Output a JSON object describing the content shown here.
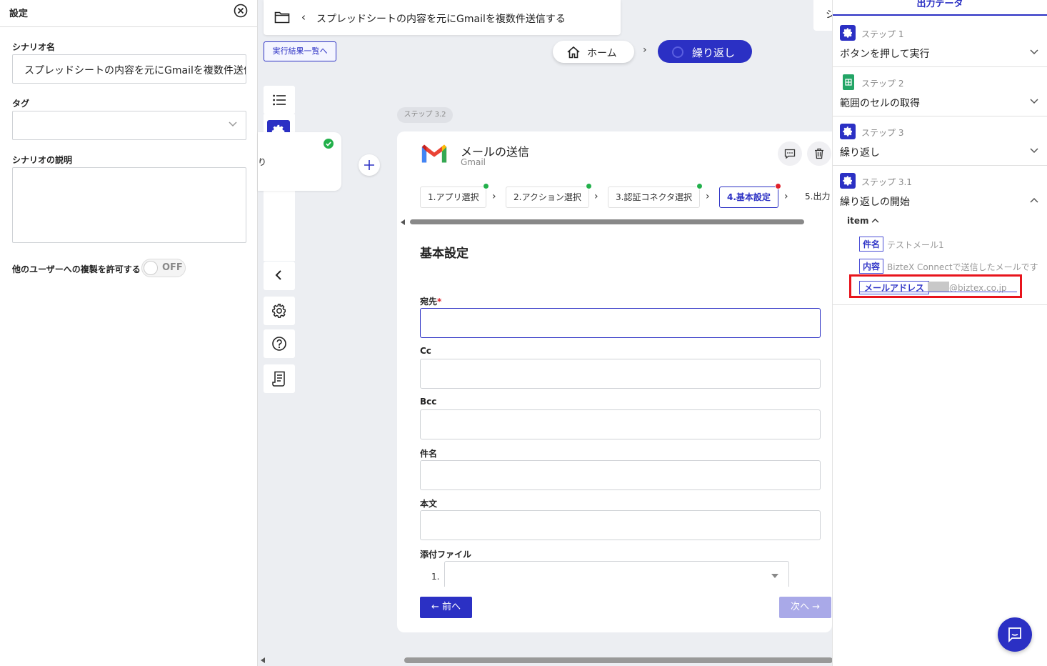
{
  "left_panel": {
    "title": "設定",
    "scenario_name_label": "シナリオ名",
    "scenario_name_value": "スプレッドシートの内容を元にGmailを複数件送信する",
    "tag_label": "タグ",
    "description_label": "シナリオの説明",
    "copy_permission_label": "他のユーザーへの複製を許可する",
    "toggle_state": "OFF"
  },
  "header": {
    "scenario_title": "スプレッドシートの内容を元にGmailを複数件送信する",
    "results_link": "実行結果一覧へ",
    "breadcrumb_home": "ホーム",
    "breadcrumb_current": "繰り返し",
    "right_truncated": "シ"
  },
  "canvas": {
    "partial_node_text": "り"
  },
  "step_card": {
    "step_badge": "ステップ 3.2",
    "title": "メールの送信",
    "subtitle": "Gmail",
    "tabs": [
      {
        "label": "1.アプリ選択",
        "status": "done"
      },
      {
        "label": "2.アクション選択",
        "status": "done"
      },
      {
        "label": "3.認証コネクタ選択",
        "status": "done"
      },
      {
        "label": "4.基本設定",
        "status": "error"
      },
      {
        "label": "5.出力"
      }
    ],
    "section_title": "基本設定",
    "fields": {
      "to_label": "宛先",
      "required_mark": "*",
      "cc_label": "Cc",
      "bcc_label": "Bcc",
      "subject_label": "件名",
      "body_label": "本文",
      "attachment_label": "添付ファイル",
      "attachment_index": "1."
    },
    "prev_button": "← 前へ",
    "next_button": "次へ →"
  },
  "right_panel": {
    "title": "出力データ",
    "steps": [
      {
        "step": "ステップ 1",
        "title": "ボタンを押して実行"
      },
      {
        "step": "ステップ 2",
        "title": "範囲のセルの取得"
      },
      {
        "step": "ステップ 3",
        "title": "繰り返し"
      },
      {
        "step": "ステップ 3.1",
        "title": "繰り返しの開始"
      }
    ],
    "item_label": "item",
    "outputs": [
      {
        "key": "件名",
        "value": "テストメール1"
      },
      {
        "key": "内容",
        "value": "BizteX Connectで送信したメールです"
      },
      {
        "key": "メールアドレス",
        "value": "@biztex.co.jp"
      }
    ]
  },
  "colors": {
    "primary": "#2b30c4",
    "highlight": "#e8141c",
    "success": "#22b04b",
    "error": "#e0202a",
    "disabled": "#a9a9e8"
  }
}
